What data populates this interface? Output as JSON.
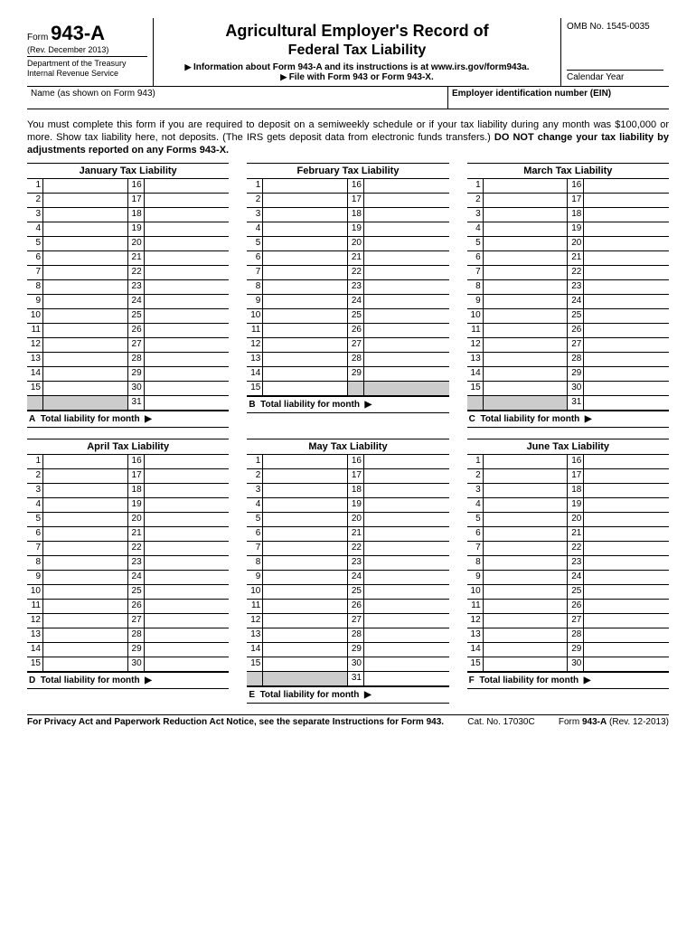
{
  "header": {
    "form_label": "Form",
    "form_number": "943-A",
    "revision": "(Rev. December 2013)",
    "dept1": "Department of the Treasury",
    "dept2": "Internal Revenue Service",
    "title1": "Agricultural Employer's Record of",
    "title2": "Federal Tax Liability",
    "info_line": "Information about Form 943-A and its instructions is at www.irs.gov/form943a.",
    "file_line": "File with Form 943 or Form 943-X.",
    "omb": "OMB No. 1545-0035",
    "calendar_year": "Calendar Year"
  },
  "name_ein": {
    "name_label": "Name (as shown on Form 943)",
    "ein_label": "Employer identification number (EIN)"
  },
  "instructions": {
    "text": "You must complete this form if you are required to deposit on a semiweekly schedule or if your tax liability during any month was $100,000 or more. Show tax liability here, not deposits. (The IRS gets deposit data from electronic funds transfers.) ",
    "bold": "DO NOT change your tax liability by adjustments reported on any Forms 943-X."
  },
  "months": [
    {
      "title": "January Tax Liability",
      "days": 31,
      "total_letter": "A",
      "total_label": "Total liability for month"
    },
    {
      "title": "February Tax Liability",
      "days": 29,
      "total_letter": "B",
      "total_label": "Total liability for month"
    },
    {
      "title": "March Tax Liability",
      "days": 31,
      "total_letter": "C",
      "total_label": "Total liability for month"
    },
    {
      "title": "April Tax Liability",
      "days": 30,
      "total_letter": "D",
      "total_label": "Total liability for month"
    },
    {
      "title": "May Tax Liability",
      "days": 31,
      "total_letter": "E",
      "total_label": "Total liability for month"
    },
    {
      "title": "June Tax Liability",
      "days": 30,
      "total_letter": "F",
      "total_label": "Total liability for month"
    }
  ],
  "footer": {
    "privacy": "For Privacy Act and Paperwork Reduction Act Notice, see the separate Instructions for Form 943.",
    "cat": "Cat. No. 17030C",
    "form_label": "Form",
    "form_number": "943-A",
    "rev": "(Rev. 12-2013)"
  }
}
